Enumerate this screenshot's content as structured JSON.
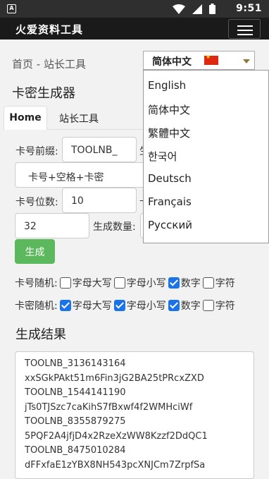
{
  "status": {
    "app_icon": "A",
    "time": "9:51"
  },
  "header": {
    "logo": "⽕爱资料工具"
  },
  "breadcrumb": "首页 - 站长工具",
  "language": {
    "selected": "简体中文",
    "options": [
      "English",
      "简体中文",
      "繁體中文",
      "한국어",
      "Deutsch",
      "Français",
      "Русский"
    ]
  },
  "page_title": "卡密生成器",
  "tabs": [
    "Home",
    "站长工具"
  ],
  "form": {
    "prefix_label": "卡号前缀:",
    "prefix_value": "TOOLNB_",
    "prefix_trailing": "生",
    "format_value": "卡号+空格+卡密",
    "digits_label": "卡号位数:",
    "digits_value": "10",
    "digits_trailing": "卡",
    "pwd_digits_value": "32",
    "count_label": "生成数量:",
    "generate_button": "生成"
  },
  "card_random": {
    "label": "卡号随机:",
    "options": [
      {
        "label": "字母大写",
        "checked": false
      },
      {
        "label": "字母小写",
        "checked": false
      },
      {
        "label": "数字",
        "checked": true
      },
      {
        "label": "字符",
        "checked": false
      }
    ]
  },
  "pwd_random": {
    "label": "卡密随机:",
    "options": [
      {
        "label": "字母大写",
        "checked": true
      },
      {
        "label": "字母小写",
        "checked": true
      },
      {
        "label": "数字",
        "checked": true
      },
      {
        "label": "字符",
        "checked": false
      }
    ]
  },
  "result": {
    "title": "生成结果",
    "lines": [
      "TOOLNB_3136143164",
      "xxSGkPAkt51m6Fin3jG2BA25tPRcxZXD",
      "TOOLNB_1544141190",
      "jTs0TJSzc7caKihS7fBxwf4f2WMHciWf",
      "TOOLNB_8355879275",
      "5PQF2A4jfjD4x2RzeXzWW8Kzzf2DdQC1",
      "TOOLNB_8475010284",
      "dFFxfaE1zYBX8NH543pcXNJCm7ZrpfSa"
    ]
  }
}
